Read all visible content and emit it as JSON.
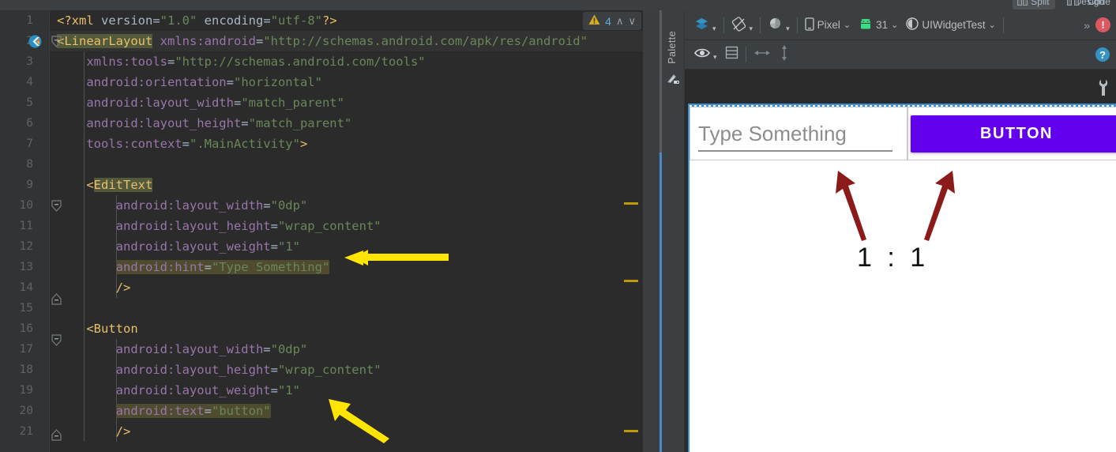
{
  "window": {
    "view_modes": [
      {
        "id": "code",
        "label": "Code",
        "selected": false
      },
      {
        "id": "split",
        "label": "Split",
        "selected": true
      },
      {
        "id": "design",
        "label": "Design",
        "selected": false
      }
    ]
  },
  "editor": {
    "warnings": {
      "icon": "warning-triangle-icon",
      "count": "4",
      "prev": "∧",
      "next": "∨"
    },
    "language": "xml",
    "lines": [
      {
        "n": "1",
        "tokens": [
          {
            "t": "<?xml ",
            "c": "t-tag"
          },
          {
            "t": "version",
            "c": "t-plain"
          },
          {
            "t": "=",
            "c": "t-punct"
          },
          {
            "t": "\"1.0\"",
            "c": "t-val"
          },
          {
            "t": " encoding",
            "c": "t-plain"
          },
          {
            "t": "=",
            "c": "t-punct"
          },
          {
            "t": "\"utf-8\"",
            "c": "t-val"
          },
          {
            "t": "?>",
            "c": "t-tag"
          }
        ]
      },
      {
        "n": "2",
        "tokens": [
          {
            "t": "<LinearLayout",
            "c": "hl-tag"
          },
          {
            "t": " ",
            "c": "t-plain"
          },
          {
            "t": "xmlns:android",
            "c": "t-attr"
          },
          {
            "t": "=",
            "c": "t-punct"
          },
          {
            "t": "\"http://schemas.android.com/apk/res/android\"",
            "c": "t-val"
          }
        ]
      },
      {
        "n": "3",
        "tokens": [
          {
            "t": "    xmlns:tools",
            "c": "t-attr"
          },
          {
            "t": "=",
            "c": "t-punct"
          },
          {
            "t": "\"http://schemas.android.com/tools\"",
            "c": "t-val"
          }
        ]
      },
      {
        "n": "4",
        "tokens": [
          {
            "t": "    android:orientation",
            "c": "t-attr"
          },
          {
            "t": "=",
            "c": "t-punct"
          },
          {
            "t": "\"horizontal\"",
            "c": "t-val"
          }
        ]
      },
      {
        "n": "5",
        "tokens": [
          {
            "t": "    android:layout_width",
            "c": "t-attr"
          },
          {
            "t": "=",
            "c": "t-punct"
          },
          {
            "t": "\"match_parent\"",
            "c": "t-val"
          }
        ]
      },
      {
        "n": "6",
        "tokens": [
          {
            "t": "    android:layout_height",
            "c": "t-attr"
          },
          {
            "t": "=",
            "c": "t-punct"
          },
          {
            "t": "\"match_parent\"",
            "c": "t-val"
          }
        ]
      },
      {
        "n": "7",
        "tokens": [
          {
            "t": "    tools:context",
            "c": "t-attr"
          },
          {
            "t": "=",
            "c": "t-punct"
          },
          {
            "t": "\".MainActivity\"",
            "c": "t-val"
          },
          {
            "t": ">",
            "c": "t-tag"
          }
        ]
      },
      {
        "n": "8",
        "tokens": []
      },
      {
        "n": "9",
        "tokens": [
          {
            "t": "    ",
            "c": "t-plain"
          },
          {
            "t": "<",
            "c": "t-tag"
          },
          {
            "t": "EditText",
            "c": "hl-tag"
          }
        ]
      },
      {
        "n": "10",
        "tokens": [
          {
            "t": "        android:layout_width",
            "c": "t-attr"
          },
          {
            "t": "=",
            "c": "t-punct"
          },
          {
            "t": "\"0dp\"",
            "c": "t-val"
          }
        ]
      },
      {
        "n": "11",
        "tokens": [
          {
            "t": "        android:layout_height",
            "c": "t-attr"
          },
          {
            "t": "=",
            "c": "t-punct"
          },
          {
            "t": "\"wrap_content\"",
            "c": "t-val"
          }
        ]
      },
      {
        "n": "12",
        "tokens": [
          {
            "t": "        android:layout_weight",
            "c": "t-attr"
          },
          {
            "t": "=",
            "c": "t-punct"
          },
          {
            "t": "\"1\"",
            "c": "t-val"
          }
        ]
      },
      {
        "n": "13",
        "tokens": [
          {
            "t": "        ",
            "c": "t-plain"
          },
          {
            "t": "android:hint",
            "c": "t-attr hl-attr"
          },
          {
            "t": "=",
            "c": "t-punct hl-attr"
          },
          {
            "t": "\"Type Something\"",
            "c": "t-val hl-attr"
          }
        ]
      },
      {
        "n": "14",
        "tokens": [
          {
            "t": "        />",
            "c": "t-tag"
          }
        ]
      },
      {
        "n": "15",
        "tokens": []
      },
      {
        "n": "16",
        "tokens": [
          {
            "t": "    <Button",
            "c": "t-tag"
          }
        ]
      },
      {
        "n": "17",
        "tokens": [
          {
            "t": "        android:layout_width",
            "c": "t-attr"
          },
          {
            "t": "=",
            "c": "t-punct"
          },
          {
            "t": "\"0dp\"",
            "c": "t-val"
          }
        ]
      },
      {
        "n": "18",
        "tokens": [
          {
            "t": "        android:layout_height",
            "c": "t-attr"
          },
          {
            "t": "=",
            "c": "t-punct"
          },
          {
            "t": "\"wrap_content\"",
            "c": "t-val"
          }
        ]
      },
      {
        "n": "19",
        "tokens": [
          {
            "t": "        android:layout_weight",
            "c": "t-attr"
          },
          {
            "t": "=",
            "c": "t-punct"
          },
          {
            "t": "\"1\"",
            "c": "t-val"
          }
        ]
      },
      {
        "n": "20",
        "tokens": [
          {
            "t": "        ",
            "c": "t-plain"
          },
          {
            "t": "android:text",
            "c": "t-attr hl-attr"
          },
          {
            "t": "=",
            "c": "t-punct hl-attr"
          },
          {
            "t": "\"button\"",
            "c": "t-val hl-attr"
          }
        ]
      },
      {
        "n": "21",
        "tokens": [
          {
            "t": "        />",
            "c": "t-tag"
          }
        ]
      }
    ]
  },
  "palette": {
    "label": "Palette",
    "icon": "palette-icon"
  },
  "design_toolbar": {
    "items": [
      {
        "id": "layers",
        "icon": "layers-icon",
        "label": ""
      },
      {
        "id": "orientation",
        "icon": "rotate-orientation-icon",
        "label": ""
      },
      {
        "id": "theme",
        "icon": "theme-contrast-icon",
        "label": ""
      },
      {
        "id": "device",
        "icon": "phone-icon",
        "label": "Pixel"
      },
      {
        "id": "api",
        "icon": "android-robot-icon",
        "label": "31"
      },
      {
        "id": "theme-name",
        "icon": "theme-circle-icon",
        "label": "UIWidgetTest"
      }
    ],
    "overflow": "»",
    "error_badge": "!",
    "help_badge": "?"
  },
  "design_toolbar2": {
    "items": [
      {
        "id": "view-mode",
        "icon": "eye-icon"
      },
      {
        "id": "blueprint",
        "icon": "blueprint-list-icon"
      },
      {
        "id": "width-constraint",
        "icon": "horizontal-arrows-icon"
      },
      {
        "id": "height-constraint",
        "icon": "vertical-arrows-icon"
      }
    ]
  },
  "preview": {
    "wrench_icon": "wrench-icon",
    "edit_text": {
      "hint": "Type Something",
      "placeholder": "Type Something"
    },
    "button": {
      "label": "BUTTON",
      "color": "#6200ee"
    },
    "annotation": {
      "ratio": "1 : 1",
      "arrow_color": "#8b1a1a"
    }
  },
  "colors": {
    "editor_bg": "#2b2b2b",
    "gutter_bg": "#313335",
    "toolbar_bg": "#3c3f41",
    "accent_blue": "#3c8fd4",
    "button_purple": "#6200ee",
    "warning_yellow": "#bb9b00",
    "code_arrow_yellow": "#ffe500"
  }
}
